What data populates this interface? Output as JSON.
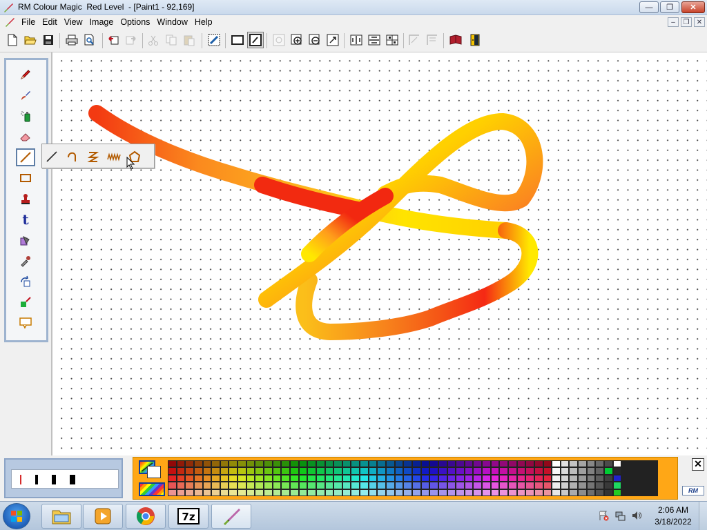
{
  "window": {
    "title": "RM Colour Magic  Red Level  - [Paint1 - 92,169]",
    "min_label": "—",
    "max_label": "❐",
    "close_label": "✕"
  },
  "menu": {
    "items": [
      "File",
      "Edit",
      "View",
      "Image",
      "Options",
      "Window",
      "Help"
    ],
    "mdi_min": "–",
    "mdi_max": "❐",
    "mdi_close": "✕"
  },
  "toolbar": {
    "buttons": [
      "new-icon",
      "open-icon",
      "save-icon",
      "print-icon",
      "print-preview-icon",
      "undo-icon",
      "redo-icon",
      "cut-icon",
      "copy-icon",
      "paste-icon",
      "select-all-icon",
      "frame-icon",
      "transparent-paste-icon",
      "zoom-window-icon",
      "zoom-in-icon",
      "zoom-out-icon",
      "zoom-actual-icon",
      "flip-horizontal-icon",
      "flip-vertical-icon",
      "grid-icon",
      "stretch-icon",
      "skew-icon",
      "book-icon",
      "exit-icon"
    ]
  },
  "tools": {
    "items": [
      "pencil-icon",
      "brush-icon",
      "spray-can-icon",
      "eraser-icon",
      "line-icon",
      "rectangle-icon",
      "stamp-icon",
      "text-icon",
      "fill-bucket-icon",
      "eyedropper-icon",
      "rotate-icon",
      "colour-replace-icon",
      "speech-bubble-icon"
    ],
    "text_tool_label": "t",
    "selected": "line-icon"
  },
  "line_flyout": {
    "items": [
      "straight-line-icon",
      "curve-icon",
      "zigzag-icon",
      "wave-icon",
      "polygon-icon"
    ]
  },
  "brush_sizes": {
    "selected": 1,
    "count": 4
  },
  "palette": {
    "current_colour_icon": "rainbow-swatch-icon",
    "secondary_colour": "#ffffff",
    "panel_colour": "#ffa716",
    "close_label": "✕",
    "logo_text": "RM"
  },
  "taskbar": {
    "apps": [
      "explorer-icon",
      "media-player-icon",
      "chrome-icon",
      "7zip-icon",
      "colour-magic-icon"
    ],
    "clock_time": "2:06 AM",
    "clock_date": "3/18/2022"
  }
}
